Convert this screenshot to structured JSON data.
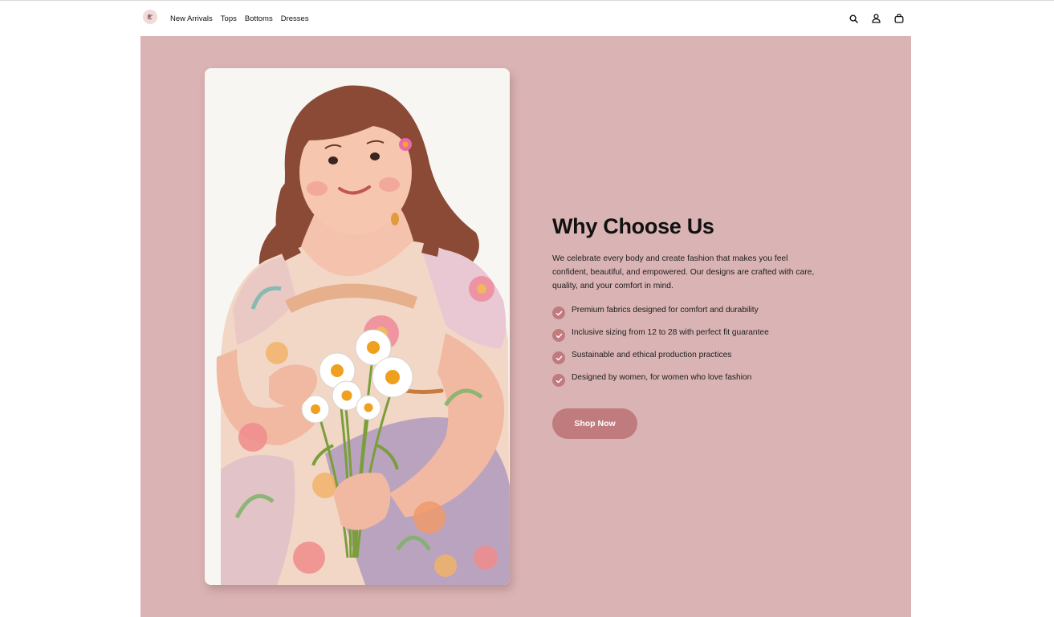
{
  "header": {
    "nav": [
      "New Arrivals",
      "Tops",
      "Bottoms",
      "Dresses"
    ],
    "icons": [
      "search-icon",
      "user-icon",
      "shopping-bag-icon"
    ]
  },
  "hero": {
    "title": "Why Choose Us",
    "description": "We celebrate every body and create fashion that makes you feel confident, beautiful, and empowered. Our designs are crafted with care, quality, and your comfort in mind.",
    "features": [
      "Premium fabrics designed for comfort and durability",
      "Inclusive sizing from 12 to 28 with perfect fit guarantee",
      "Sustainable and ethical production practices",
      "Designed by women, for women who love fashion"
    ],
    "cta_label": "Shop Now"
  },
  "colors": {
    "hero_background": "#dab3b4",
    "accent": "#c07b7e",
    "text": "#111111"
  }
}
